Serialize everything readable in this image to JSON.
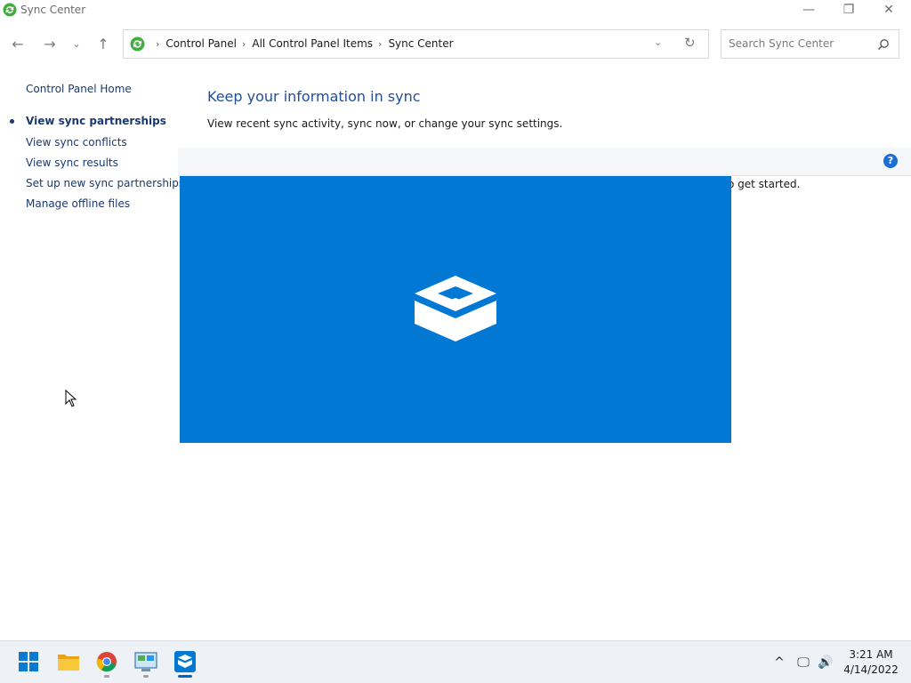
{
  "window": {
    "title": "Sync Center",
    "controls": {
      "minimize": "—",
      "maximize": "❐",
      "close": "✕"
    }
  },
  "nav": {
    "back": "←",
    "forward": "→",
    "recent": "⌄",
    "up": "↑"
  },
  "address": {
    "breadcrumbs": [
      "Control Panel",
      "All Control Panel Items",
      "Sync Center"
    ],
    "separator": "›",
    "dropdown": "⌄",
    "refresh": "↻"
  },
  "search": {
    "placeholder": "Search Sync Center"
  },
  "sidebar": {
    "home": "Control Panel Home",
    "items": [
      {
        "label": "View sync partnerships",
        "active": true
      },
      {
        "label": "View sync conflicts"
      },
      {
        "label": "View sync results"
      },
      {
        "label": "Set up new sync partnerships"
      },
      {
        "label": "Manage offline files"
      }
    ]
  },
  "main": {
    "title": "Keep your information in sync",
    "description": "View recent sync activity, sync now, or change your sync settings.",
    "help": "?",
    "partial_text": "o get started."
  },
  "colors": {
    "accent": "#0078d4",
    "link": "#1a3a6e",
    "title": "#1f4e9a",
    "sync_green": "#3fae3f"
  },
  "taskbar": {
    "apps": [
      "start-icon",
      "file-explorer-icon",
      "chrome-icon",
      "control-panel-icon",
      "sync-center-app-icon"
    ],
    "tray": {
      "chevron": "^",
      "network": "🖵",
      "volume": "🔊"
    },
    "clock": {
      "time": "3:21 AM",
      "date": "4/14/2022"
    }
  }
}
